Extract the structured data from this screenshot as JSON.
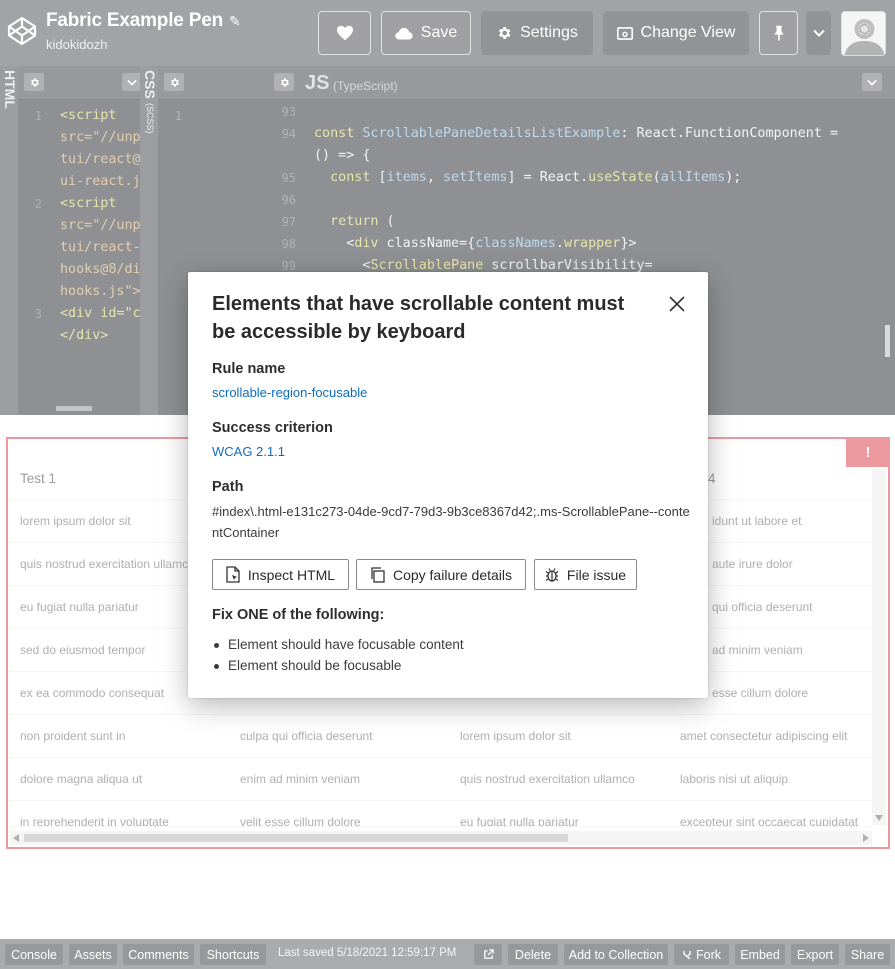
{
  "header": {
    "pen_title": "Fabric Example Pen",
    "username": "kidokidozh",
    "save_label": "Save",
    "settings_label": "Settings",
    "change_view_label": "Change View"
  },
  "editors": {
    "html_label": "HTML",
    "css_label": "CSS",
    "css_sub": "(SCSS)",
    "js_label": "JS",
    "js_sub": "(TypeScript)",
    "html_line_numbers": [
      "1",
      "2",
      "3"
    ],
    "html_code": [
      "<script",
      "src=\"//unp",
      "tui/react@",
      "ui-react.j",
      "<script",
      "src=\"//unp",
      "tui/react-",
      "hooks@8/di",
      "hooks.js\">",
      "<div id=\"c",
      "</div>"
    ],
    "css_line_numbers": [
      "1"
    ],
    "js_line_numbers": [
      "93",
      "94",
      "95",
      "96",
      "97",
      "98",
      "99"
    ]
  },
  "table": {
    "headers": [
      "Test 1",
      "",
      "",
      "4"
    ],
    "rows": [
      [
        "lorem ipsum dolor sit",
        "",
        "",
        "idunt ut labore et"
      ],
      [
        "quis nostrud exercitation ullamco",
        "",
        "",
        "aute irure dolor"
      ],
      [
        "eu fugiat nulla pariatur",
        "",
        "",
        "qui officia deserunt"
      ],
      [
        "sed do eiusmod tempor",
        "",
        "",
        "ad minim veniam"
      ],
      [
        "ex ea commodo consequat",
        "",
        "",
        "esse cillum dolore"
      ],
      [
        "non proident sunt in",
        "culpa qui officia deserunt",
        "lorem ipsum dolor sit",
        "amet consectetur adipiscing elit"
      ],
      [
        "dolore magna aliqua ut",
        "enim ad minim veniam",
        "quis nostrud exercitation ullamco",
        "laboris nisi ut aliquip"
      ],
      [
        "in reprehenderit in voluptate",
        "velit esse cillum dolore",
        "eu fugiat nulla pariatur",
        "excepteur sint occaecat cupidatat"
      ]
    ],
    "alert_badge": "!"
  },
  "dialog": {
    "title": "Elements that have scrollable content must be accessible by keyboard",
    "rule_name_heading": "Rule name",
    "rule_name_value": "scrollable-region-focusable",
    "success_heading": "Success criterion",
    "success_value": "WCAG 2.1.1",
    "path_heading": "Path",
    "path_value": "#index\\.html-e131c273-04de-9cd7-79d3-9b3ce8367d42;.ms-ScrollablePane--contentContainer",
    "inspect_label": "Inspect HTML",
    "copy_label": "Copy failure details",
    "file_issue_label": "File issue",
    "fix_heading": "Fix ONE of the following:",
    "fix_items": [
      "Element should have focusable content",
      "Element should be focusable"
    ]
  },
  "footer": {
    "console": "Console",
    "assets": "Assets",
    "comments": "Comments",
    "shortcuts": "Shortcuts",
    "last_saved": "Last saved 5/18/2021 12:59:17 PM",
    "delete": "Delete",
    "add_to_collection": "Add to Collection",
    "fork": "Fork",
    "embed": "Embed",
    "export": "Export",
    "share": "Share"
  },
  "colors": {
    "header_bg": "#77787c",
    "editor_bg": "#5b5c60",
    "alert_red": "#e46a72",
    "link_blue": "#0f6cbd"
  }
}
